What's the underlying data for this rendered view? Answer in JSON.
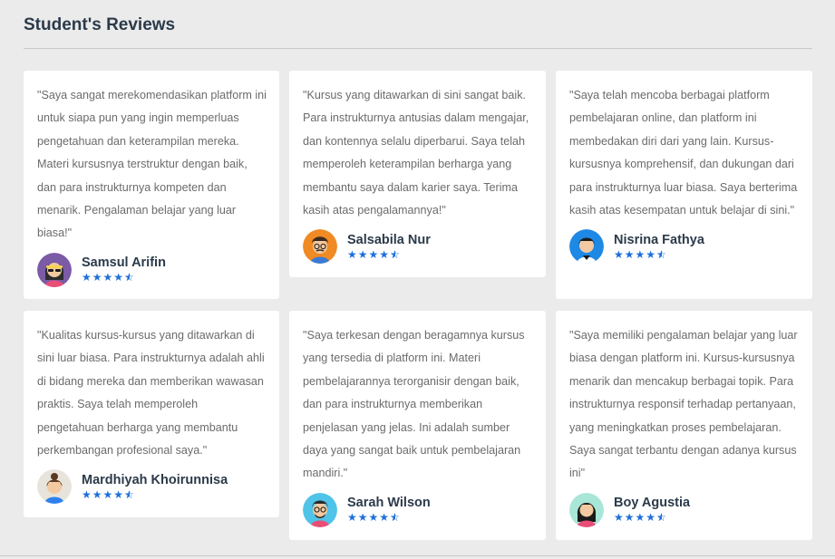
{
  "section": {
    "title": "Student's Reviews"
  },
  "theme": {
    "star_color": "#1e6fd9",
    "name_color": "#2b3a4a",
    "text_color": "#6b6b6b"
  },
  "reviews": [
    {
      "text": "\"Saya sangat merekomendasikan platform ini untuk siapa pun yang ingin memperluas pengetahuan dan keterampilan mereka. Materi kursusnya terstruktur dengan baik, dan para instrukturnya kompeten dan menarik. Pengalaman belajar yang luar biasa!\"",
      "name": "Samsul Arifin",
      "rating": 4.5,
      "avatar_icon": "woman-sunglasses-avatar-icon"
    },
    {
      "text": "\"Kursus yang ditawarkan di sini sangat baik. Para instrukturnya antusias dalam mengajar, dan kontennya selalu diperbarui. Saya telah memperoleh keterampilan berharga yang membantu saya dalam karier saya. Terima kasih atas pengalamannya!\"",
      "name": "Salsabila Nur",
      "rating": 4.5,
      "avatar_icon": "man-glasses-avatar-icon"
    },
    {
      "text": "\"Saya telah mencoba berbagai platform pembelajaran online, dan platform ini membedakan diri dari yang lain. Kursus-kursusnya komprehensif, dan dukungan dari para instrukturnya luar biasa. Saya berterima kasih atas kesempatan untuk belajar di sini.\"",
      "name": "Nisrina Fathya",
      "rating": 4.5,
      "avatar_icon": "man-dark-hair-avatar-icon"
    },
    {
      "text": "\"Kualitas kursus-kursus yang ditawarkan di sini luar biasa. Para instrukturnya adalah ahli di bidang mereka dan memberikan wawasan praktis. Saya telah memperoleh pengetahuan berharga yang membantu perkembangan profesional saya.\"",
      "name": "Mardhiyah Khoirunnisa",
      "rating": 4.5,
      "avatar_icon": "woman-bun-avatar-icon"
    },
    {
      "text": "\"Saya terkesan dengan beragamnya kursus yang tersedia di platform ini. Materi pembelajarannya terorganisir dengan baik, dan para instrukturnya memberikan penjelasan yang jelas. Ini adalah sumber daya yang sangat baik untuk pembelajaran mandiri.\"",
      "name": "Sarah Wilson",
      "rating": 4.5,
      "avatar_icon": "man-glasses-beard-avatar-icon"
    },
    {
      "text": "\"Saya memiliki pengalaman belajar yang luar biasa dengan platform ini. Kursus-kursusnya menarik dan mencakup berbagai topik. Para instrukturnya responsif terhadap pertanyaan, yang meningkatkan proses pembelajaran. Saya sangat terbantu dengan adanya kursus ini\"",
      "name": "Boy Agustia",
      "rating": 4.5,
      "avatar_icon": "woman-long-hair-avatar-icon"
    }
  ]
}
